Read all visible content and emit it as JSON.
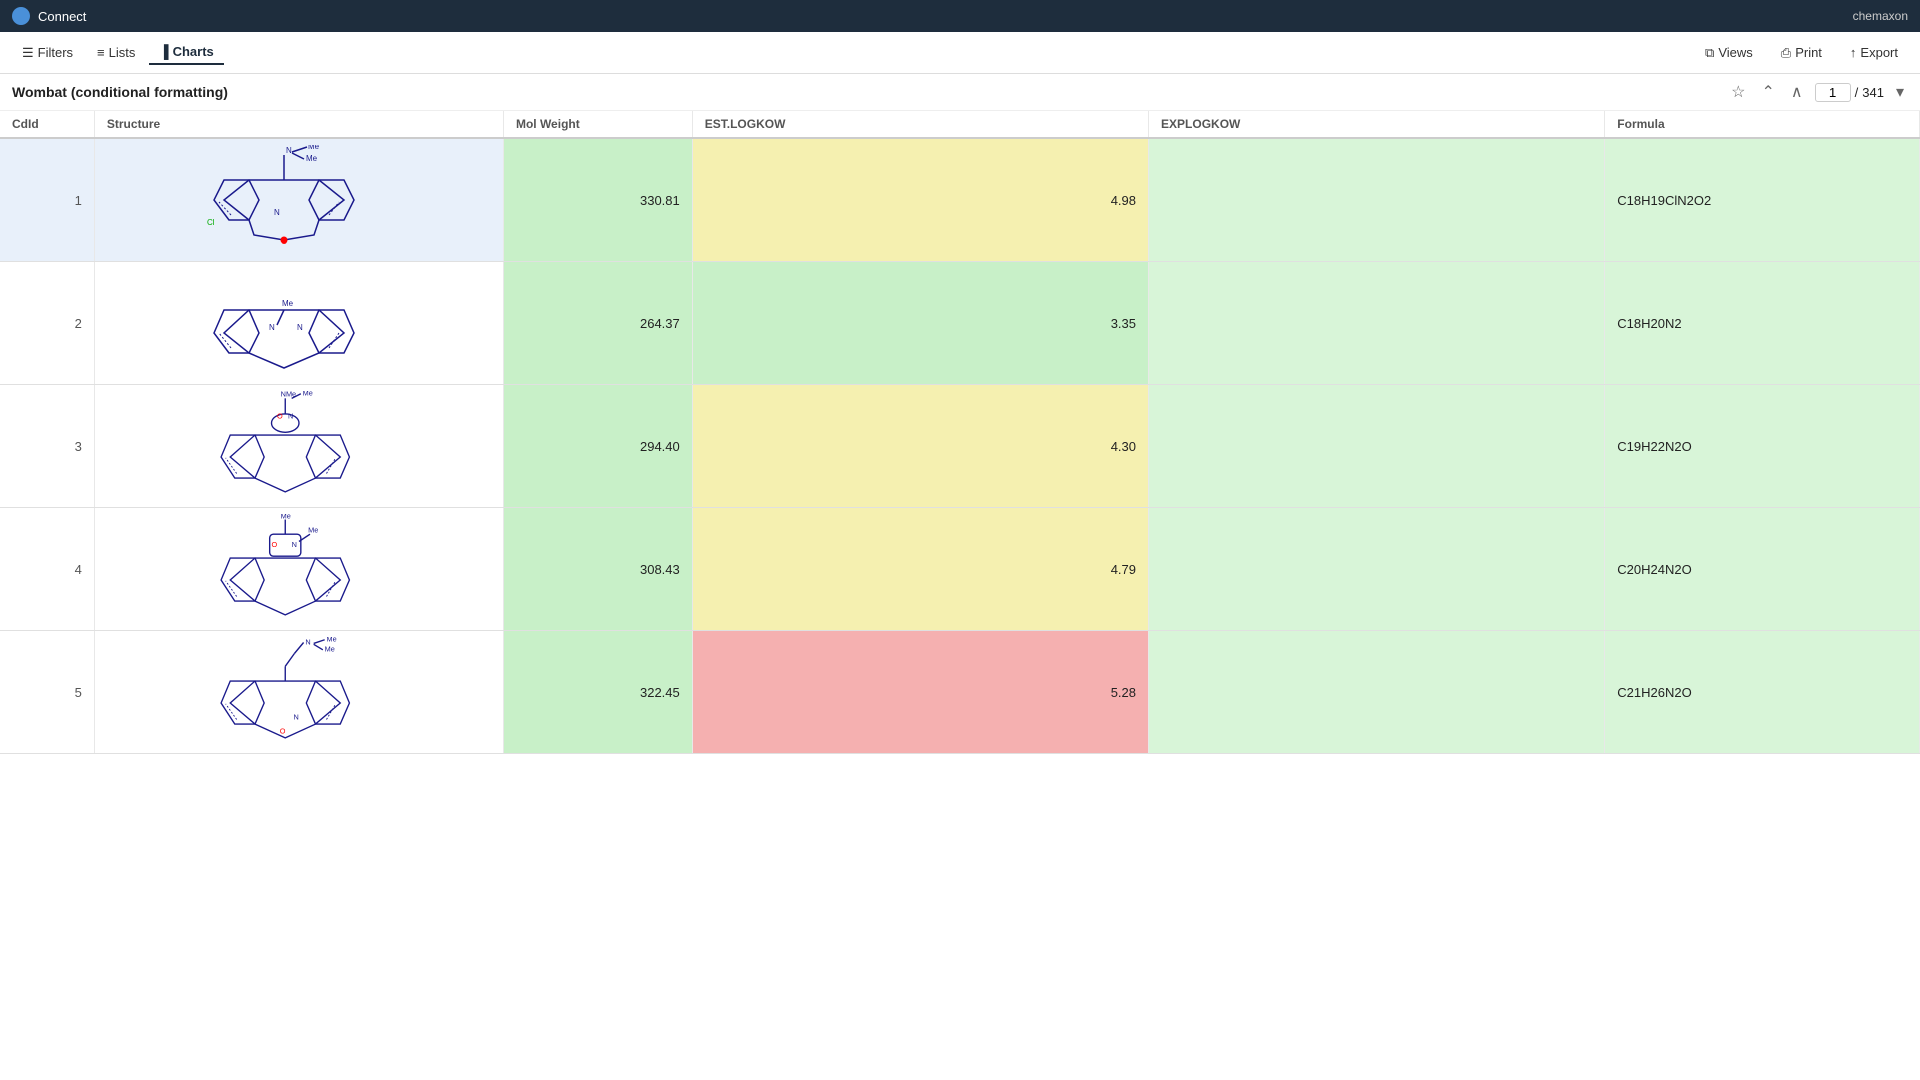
{
  "topbar": {
    "app_name": "Connect",
    "user": "chemaxon"
  },
  "toolbar": {
    "filters_label": "Filters",
    "lists_label": "Lists",
    "charts_label": "Charts",
    "views_label": "Views",
    "print_label": "Print",
    "export_label": "Export"
  },
  "page": {
    "title": "Wombat (conditional formatting)",
    "current_page": "1",
    "total_pages": "341"
  },
  "table": {
    "columns": [
      "CdId",
      "Structure",
      "Mol Weight",
      "EST.LOGKOW",
      "EXPLOGKOW",
      "Formula"
    ],
    "rows": [
      {
        "id": 1,
        "mol_weight": "330.81",
        "est_logkow": "4.98",
        "exp_logkow": "",
        "formula": "C18H19ClN2O2",
        "mol_weight_class": "cell-green",
        "est_logkow_class": "cell-yellow",
        "exp_logkow_class": "cell-green-light",
        "formula_class": "cell-green-light",
        "selected": true
      },
      {
        "id": 2,
        "mol_weight": "264.37",
        "est_logkow": "3.35",
        "exp_logkow": "",
        "formula": "C18H20N2",
        "mol_weight_class": "cell-green",
        "est_logkow_class": "cell-green",
        "exp_logkow_class": "cell-green-light",
        "formula_class": "cell-green-light",
        "selected": false
      },
      {
        "id": 3,
        "mol_weight": "294.40",
        "est_logkow": "4.30",
        "exp_logkow": "",
        "formula": "C19H22N2O",
        "mol_weight_class": "cell-green",
        "est_logkow_class": "cell-yellow",
        "exp_logkow_class": "cell-green-light",
        "formula_class": "cell-green-light",
        "selected": false
      },
      {
        "id": 4,
        "mol_weight": "308.43",
        "est_logkow": "4.79",
        "exp_logkow": "",
        "formula": "C20H24N2O",
        "mol_weight_class": "cell-green",
        "est_logkow_class": "cell-yellow",
        "exp_logkow_class": "cell-green-light",
        "formula_class": "cell-green-light",
        "selected": false
      },
      {
        "id": 5,
        "mol_weight": "322.45",
        "est_logkow": "5.28",
        "exp_logkow": "",
        "formula": "C21H26N2O",
        "mol_weight_class": "cell-green",
        "est_logkow_class": "cell-red",
        "exp_logkow_class": "cell-green-light",
        "formula_class": "cell-green-light",
        "selected": false
      }
    ]
  },
  "molecules": [
    {
      "id": 1,
      "svg_desc": "chloro-substituted tricyclic with dimethylaminomethyl group"
    },
    {
      "id": 2,
      "svg_desc": "tricyclic with methylpiperazine"
    },
    {
      "id": 3,
      "svg_desc": "tricyclic with oxazolidine and dimethyl"
    },
    {
      "id": 4,
      "svg_desc": "tricyclic with morpholine-like ring"
    },
    {
      "id": 5,
      "svg_desc": "tricyclic with dimethylaminopropyl"
    }
  ]
}
